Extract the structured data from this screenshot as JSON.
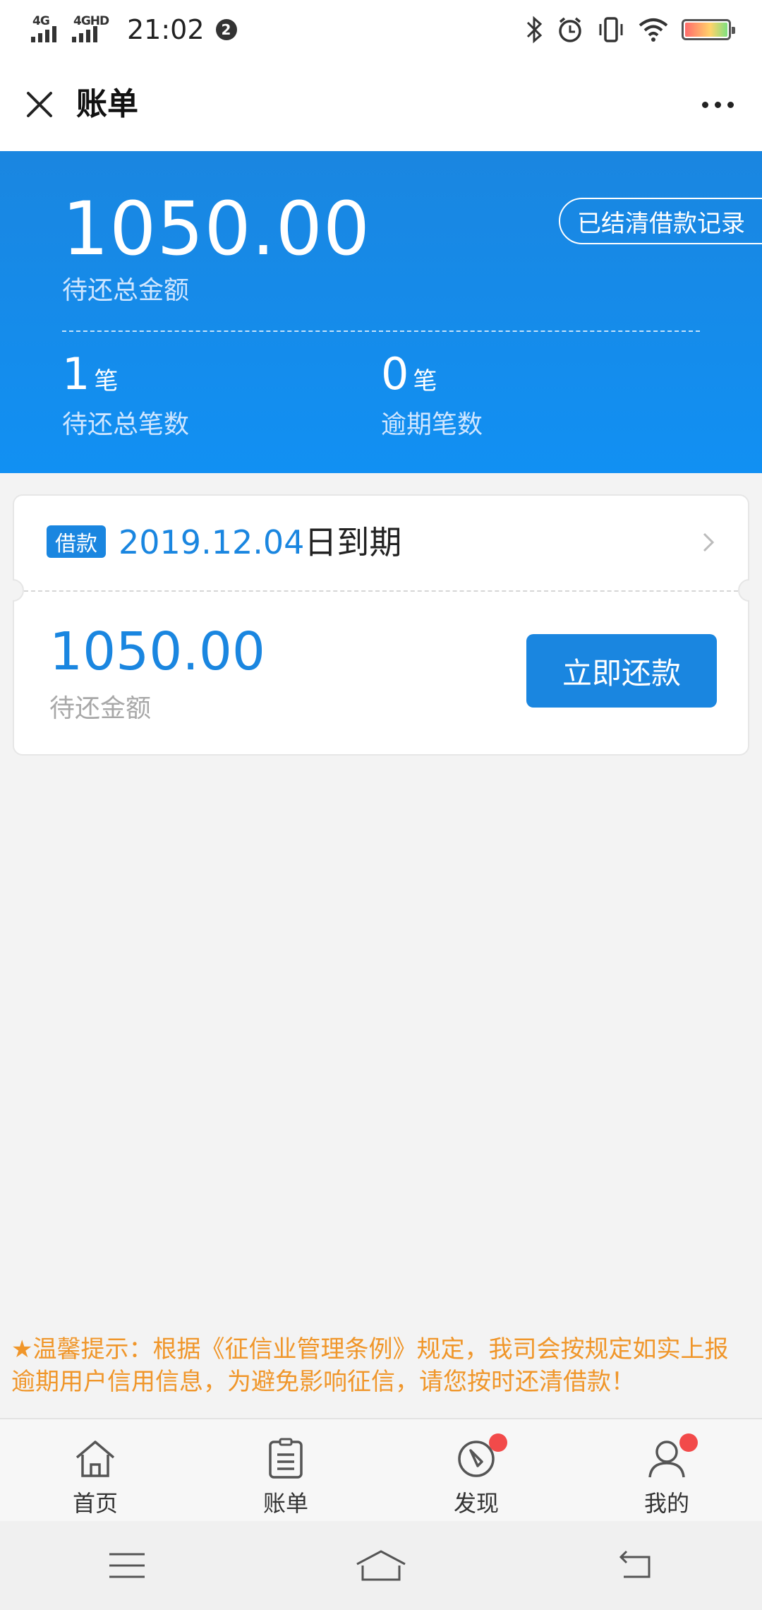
{
  "status_bar": {
    "network1": "4G",
    "network2": "4GHD",
    "time": "21:02",
    "notification_count": "2",
    "icons": [
      "bluetooth-icon",
      "alarm-icon",
      "vibrate-icon",
      "wifi-icon",
      "battery-icon"
    ]
  },
  "nav": {
    "title": "账单",
    "close_icon": "close-icon",
    "more_icon": "more-icon"
  },
  "summary": {
    "total_amount": "1050.00",
    "total_amount_label": "待还总金额",
    "settled_records_label": "已结清借款记录",
    "pending_count": "1",
    "pending_unit": "笔",
    "pending_label": "待还总笔数",
    "overdue_count": "0",
    "overdue_unit": "笔",
    "overdue_label": "逾期笔数"
  },
  "loan_card": {
    "tag": "借款",
    "due_date": "2019.12.04",
    "due_suffix": "日到期",
    "amount": "1050.00",
    "amount_label": "待还金额",
    "repay_button": "立即还款"
  },
  "notice": "★温馨提示：根据《征信业管理条例》规定，我司会按规定如实上报逾期用户信用信息，为避免影响征信，请您按时还清借款！",
  "tabs": [
    {
      "label": "首页",
      "icon": "home-icon",
      "badge": false
    },
    {
      "label": "账单",
      "icon": "bill-icon",
      "badge": false
    },
    {
      "label": "发现",
      "icon": "compass-icon",
      "badge": true
    },
    {
      "label": "我的",
      "icon": "profile-icon",
      "badge": true
    }
  ],
  "colors": {
    "primary": "#1a86e0",
    "warning": "#f0962a",
    "badge": "#f24a4a"
  }
}
